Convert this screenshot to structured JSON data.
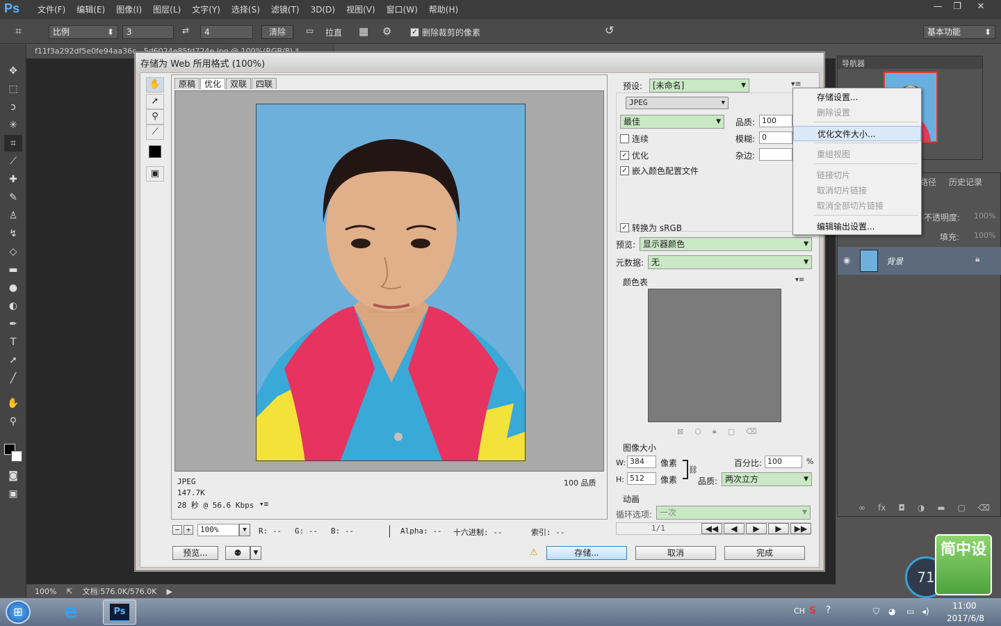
{
  "app": {
    "logo": "Ps",
    "menu": [
      "文件(F)",
      "编辑(E)",
      "图像(I)",
      "图层(L)",
      "文字(Y)",
      "选择(S)",
      "滤镜(T)",
      "3D(D)",
      "视图(V)",
      "窗口(W)",
      "帮助(H)"
    ],
    "window_buttons": [
      "—",
      "❐",
      "✕"
    ]
  },
  "options_bar": {
    "ratio_select": "比例",
    "width_value": "3",
    "height_value": "4",
    "clear_button": "清除",
    "straighten_label": "拉直",
    "delete_cropped_label": "删除裁剪的像素",
    "delete_cropped_checked": true,
    "workspace_select": "基本功能"
  },
  "document_tab": "f11f3a292df5e0fe94aa36c...5d6024e85fd724e.jpg @ 100%(RGB/8) *",
  "status_bar": {
    "zoom": "100%",
    "doc": "文档:576.0K/576.0K"
  },
  "panels": {
    "navigator_tab": "导航器",
    "paths_tab": "路径",
    "history_tab": "历史记录",
    "opacity_label": "不透明度:",
    "opacity_value": "100%",
    "fill_label": "填充:",
    "fill_value": "100%",
    "layer_name": "背景"
  },
  "dialog": {
    "title": "存储为 Web 所用格式 (100%)",
    "view_tabs": [
      "原稿",
      "优化",
      "双联",
      "四联"
    ],
    "active_tab": "优化",
    "info": {
      "format": "JPEG",
      "size": "147.7K",
      "time": "28 秒 @ 56.6 Kbps",
      "quality_text": "100 品质"
    },
    "bottom": {
      "zoom": "100%",
      "r": "R: --",
      "g": "G: --",
      "b": "B: --",
      "alpha": "Alpha: --",
      "hex": "十六进制: --",
      "index": "索引: --"
    },
    "preview_button": "预览...",
    "save_button": "存储...",
    "cancel_button": "取消",
    "done_button": "完成",
    "settings": {
      "preset_label": "预设:",
      "preset_value": "[未命名]",
      "format_value": "JPEG",
      "quality_preset": "最佳",
      "quality_label": "品质:",
      "quality_value": "100",
      "blur_label": "模糊:",
      "blur_value": "0",
      "matte_label": "杂边:",
      "progressive_label": "连续",
      "progressive_checked": false,
      "optimized_label": "优化",
      "optimized_checked": true,
      "embed_profile_label": "嵌入颜色配置文件",
      "embed_profile_checked": true,
      "convert_srgb_label": "转换为 sRGB",
      "convert_srgb_checked": true,
      "preview_label": "预览:",
      "preview_value": "显示器颜色",
      "metadata_label": "元数据:",
      "metadata_value": "无",
      "color_table_label": "颜色表",
      "image_size_label": "图像大小",
      "w_label": "W:",
      "w_value": "384",
      "h_label": "H:",
      "h_value": "512",
      "px_label": "像素",
      "percent_label": "百分比:",
      "percent_value": "100",
      "percent_unit": "%",
      "resample_label": "品质:",
      "resample_value": "两次立方",
      "animation_label": "动画",
      "loop_label": "循环选项:",
      "loop_value": "一次",
      "frame_counter": "1/1"
    },
    "flyout_menu": [
      {
        "label": "存储设置...",
        "enabled": true
      },
      {
        "label": "删除设置",
        "enabled": false
      },
      {
        "label": "优化文件大小...",
        "enabled": true,
        "highlighted": true
      },
      {
        "label": "重组视图",
        "enabled": false
      },
      {
        "label": "链接切片",
        "enabled": false
      },
      {
        "label": "取消切片链接",
        "enabled": false
      },
      {
        "label": "取消全部切片链接",
        "enabled": false
      },
      {
        "label": "编辑输出设置...",
        "enabled": true
      }
    ]
  },
  "taskbar": {
    "clock_time": "11:00",
    "clock_date": "2017/6/8",
    "lang": "CH",
    "badge_number": "71",
    "sticker_text": "简中设"
  },
  "colors": {
    "green_field": "#c9e8c4",
    "ps_blue": "#5ab4ff",
    "photo_bg": "#6eb0dc"
  }
}
